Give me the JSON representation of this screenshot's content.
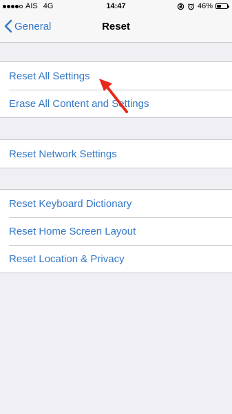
{
  "status_bar": {
    "carrier": "AIS",
    "network": "4G",
    "time": "14:47",
    "battery_percent": "46%",
    "battery_level": 0.46,
    "signal_strength": 4
  },
  "nav": {
    "back_label": "General",
    "title": "Reset"
  },
  "groups": [
    {
      "items": [
        "Reset All Settings",
        "Erase All Content and Settings"
      ]
    },
    {
      "items": [
        "Reset Network Settings"
      ]
    },
    {
      "items": [
        "Reset Keyboard Dictionary",
        "Reset Home Screen Layout",
        "Reset Location & Privacy"
      ]
    }
  ],
  "colors": {
    "accent": "#3478c6",
    "background": "#efeff4",
    "annotation": "#e8291c"
  },
  "icons": {
    "back": "chevron-left-icon",
    "rotation_lock": "rotation-lock-icon",
    "alarm": "alarm-icon",
    "battery": "battery-icon",
    "annotation": "red-arrow-annotation"
  }
}
